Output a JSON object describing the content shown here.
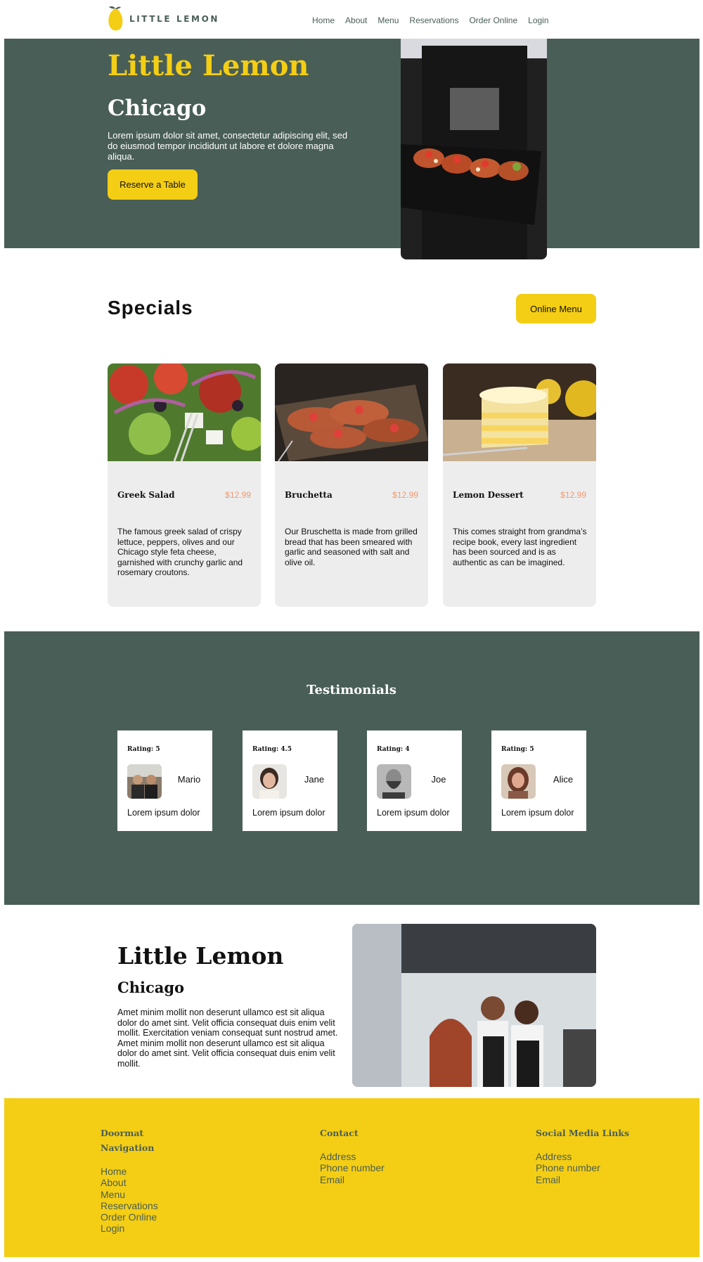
{
  "header": {
    "logo_text": "LITTLE LEMON",
    "nav": [
      "Home",
      "About",
      "Menu",
      "Reservations",
      "Order Online",
      "Login"
    ]
  },
  "hero": {
    "title": "Little Lemon",
    "subtitle": "Chicago",
    "description": "Lorem ipsum dolor sit amet, consectetur adipiscing elit, sed do eiusmod tempor incididunt ut labore et dolore magna aliqua.",
    "button": "Reserve a Table"
  },
  "specials": {
    "title": "Specials",
    "button": "Online Menu",
    "items": [
      {
        "name": "Greek Salad",
        "price": "$12.99",
        "description": "The famous greek salad of crispy lettuce, peppers, olives and our Chicago style feta cheese, garnished with crunchy garlic and rosemary croutons."
      },
      {
        "name": "Bruchetta",
        "price": "$12.99",
        "description": "Our Bruschetta is made from grilled bread that has been smeared with garlic and seasoned with salt and olive oil."
      },
      {
        "name": "Lemon Dessert",
        "price": "$12.99",
        "description": "This comes straight from grandma’s recipe book, every last ingredient has been sourced and is as authentic as can be imagined."
      }
    ]
  },
  "testimonials": {
    "title": "Testimonials",
    "items": [
      {
        "rating": "Rating: 5",
        "name": "Mario",
        "review": "Lorem ipsum dolor"
      },
      {
        "rating": "Rating: 4.5",
        "name": "Jane",
        "review": "Lorem ipsum dolor"
      },
      {
        "rating": "Rating: 4",
        "name": "Joe",
        "review": "Lorem ipsum dolor"
      },
      {
        "rating": "Rating: 5",
        "name": "Alice",
        "review": "Lorem ipsum dolor"
      }
    ]
  },
  "about": {
    "title": "Little Lemon",
    "subtitle": "Chicago",
    "description": "Amet minim mollit non deserunt ullamco est sit aliqua dolor do amet sint. Velit officia consequat duis enim velit mollit. Exercitation veniam consequat sunt nostrud amet. Amet minim mollit non deserunt ullamco est sit aliqua dolor do amet sint. Velit officia consequat duis enim velit mollit."
  },
  "footer": {
    "nav_heading": "Doormat Navigation",
    "nav_links": [
      "Home",
      "About",
      "Menu",
      "Reservations",
      "Order Online",
      "Login"
    ],
    "contact_heading": "Contact",
    "contact_links": [
      "Address",
      "Phone number",
      "Email"
    ],
    "social_heading": "Social Media Links",
    "social_links": [
      "Address",
      "Phone number",
      "Email"
    ]
  },
  "colors": {
    "primary_green": "#495e57",
    "primary_yellow": "#f4ce14",
    "accent_salmon": "#ee9972",
    "card_bg": "#ededed"
  }
}
